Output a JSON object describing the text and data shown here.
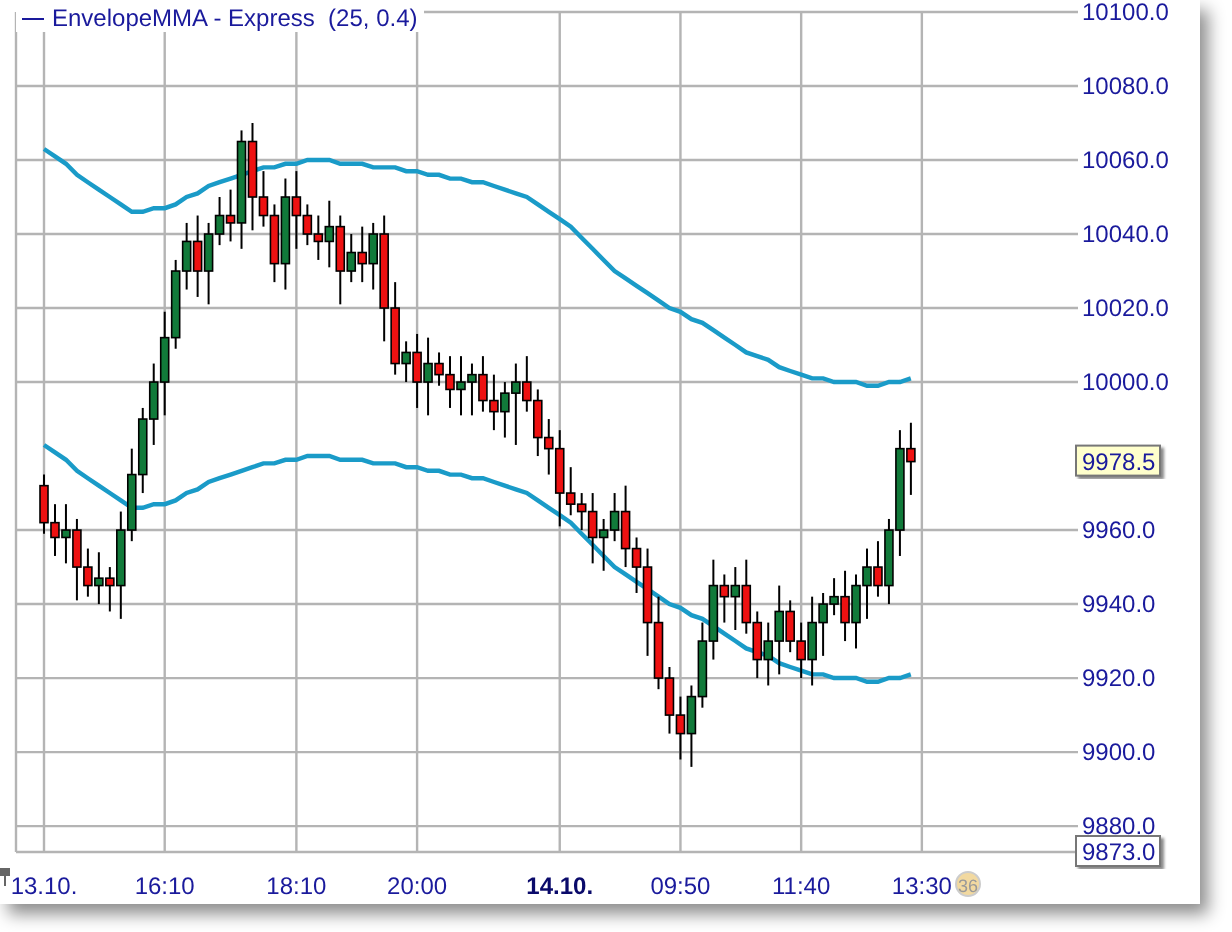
{
  "panel": {
    "chart_data": {
      "type": "candlestick",
      "title": "EnvelopeMMA - Express  (25, 0.4)",
      "categories": [
        "13.10.",
        null,
        null,
        null,
        null,
        null,
        null,
        null,
        null,
        null,
        null,
        "16:10",
        null,
        null,
        null,
        null,
        null,
        null,
        null,
        null,
        null,
        null,
        null,
        "18:10",
        null,
        null,
        null,
        null,
        null,
        null,
        null,
        null,
        null,
        null,
        "20:00",
        null,
        null,
        null,
        null,
        null,
        null,
        null,
        null,
        null,
        null,
        null,
        null,
        "**14.10.**",
        null,
        null,
        null,
        null,
        null,
        null,
        null,
        null,
        null,
        null,
        "09:50",
        null,
        null,
        null,
        null,
        null,
        null,
        null,
        null,
        null,
        null,
        "11:40",
        null,
        null,
        null,
        null,
        null,
        null,
        null,
        null,
        null,
        null,
        "13:30",
        null,
        null,
        null,
        null,
        null,
        null,
        null,
        null,
        null,
        null,
        null,
        null,
        null
      ],
      "grid": true,
      "ylim": [
        9873,
        10100
      ],
      "yticks": [
        {
          "value": 9880,
          "label": "9880.0"
        },
        {
          "value": 9900,
          "label": "9900.0"
        },
        {
          "value": 9920,
          "label": "9920.0"
        },
        {
          "value": 9940,
          "label": "9940.0"
        },
        {
          "value": 9960,
          "label": "9960.0"
        },
        {
          "value": 10000,
          "label": "10000.0"
        },
        {
          "value": 10020,
          "label": "10020.0"
        },
        {
          "value": 10040,
          "label": "10040.0"
        },
        {
          "value": 10060,
          "label": "10060.0"
        },
        {
          "value": 10080,
          "label": "10080.0"
        },
        {
          "value": 10100,
          "label": "10100.0"
        }
      ],
      "ohlc": [
        [
          9972,
          9975,
          9959,
          9962
        ],
        [
          9962,
          9967,
          9953,
          9958
        ],
        [
          9958,
          9967,
          9951,
          9960
        ],
        [
          9960,
          9963,
          9941,
          9950
        ],
        [
          9950,
          9955,
          9942,
          9945
        ],
        [
          9945,
          9954,
          9940,
          9947
        ],
        [
          9947,
          9950,
          9938,
          9945
        ],
        [
          9945,
          9965,
          9936,
          9960
        ],
        [
          9960,
          9982,
          9957,
          9975
        ],
        [
          9975,
          9993,
          9970,
          9990
        ],
        [
          9990,
          10005,
          9983,
          10000
        ],
        [
          10000,
          10019,
          9991,
          10012
        ],
        [
          10012,
          10033,
          10009,
          10030
        ],
        [
          10030,
          10043,
          10025,
          10038
        ],
        [
          10038,
          10045,
          10023,
          10030
        ],
        [
          10030,
          10043,
          10021,
          10040
        ],
        [
          10040,
          10050,
          10037,
          10045
        ],
        [
          10045,
          10052,
          10038,
          10043
        ],
        [
          10043,
          10068,
          10036,
          10065
        ],
        [
          10065,
          10070,
          10041,
          10050
        ],
        [
          10050,
          10057,
          10042,
          10045
        ],
        [
          10045,
          10048,
          10027,
          10032
        ],
        [
          10032,
          10055,
          10025,
          10050
        ],
        [
          10050,
          10057,
          10036,
          10045
        ],
        [
          10045,
          10048,
          10037,
          10040
        ],
        [
          10040,
          10045,
          10033,
          10038
        ],
        [
          10038,
          10049,
          10031,
          10042
        ],
        [
          10042,
          10045,
          10021,
          10030
        ],
        [
          10030,
          10040,
          10027,
          10035
        ],
        [
          10035,
          10042,
          10027,
          10032
        ],
        [
          10032,
          10043,
          10025,
          10040
        ],
        [
          10040,
          10045,
          10011,
          10020
        ],
        [
          10020,
          10027,
          10002,
          10005
        ],
        [
          10005,
          10011,
          10000,
          10008
        ],
        [
          10008,
          10013,
          9993,
          10000
        ],
        [
          10000,
          10012,
          9991,
          10005
        ],
        [
          10005,
          10008,
          9999,
          10002
        ],
        [
          10002,
          10007,
          9993,
          9998
        ],
        [
          9998,
          10007,
          9991,
          10000
        ],
        [
          10000,
          10005,
          9991,
          10002
        ],
        [
          10002,
          10007,
          9992,
          9995
        ],
        [
          9995,
          10002,
          9987,
          9992
        ],
        [
          9992,
          10000,
          9985,
          9997
        ],
        [
          9997,
          10005,
          9983,
          10000
        ],
        [
          10000,
          10007,
          9992,
          9995
        ],
        [
          9995,
          9998,
          9980,
          9985
        ],
        [
          9985,
          9990,
          9975,
          9982
        ],
        [
          9982,
          9987,
          9961,
          9970
        ],
        [
          9970,
          9977,
          9964,
          9967
        ],
        [
          9967,
          9970,
          9960,
          9965
        ],
        [
          9965,
          9970,
          9951,
          9958
        ],
        [
          9958,
          9963,
          9949,
          9960
        ],
        [
          9960,
          9970,
          9957,
          9965
        ],
        [
          9965,
          9972,
          9950,
          9955
        ],
        [
          9955,
          9958,
          9943,
          9950
        ],
        [
          9950,
          9955,
          9926,
          9935
        ],
        [
          9935,
          9942,
          9917,
          9920
        ],
        [
          9920,
          9923,
          9905,
          9910
        ],
        [
          9910,
          9915,
          9898,
          9905
        ],
        [
          9905,
          9918,
          9896,
          9915
        ],
        [
          9915,
          9935,
          9912,
          9930
        ],
        [
          9930,
          9952,
          9925,
          9945
        ],
        [
          9945,
          9948,
          9935,
          9942
        ],
        [
          9942,
          9950,
          9933,
          9945
        ],
        [
          9945,
          9952,
          9932,
          9935
        ],
        [
          9935,
          9938,
          9920,
          9925
        ],
        [
          9925,
          9935,
          9918,
          9930
        ],
        [
          9930,
          9945,
          9921,
          9938
        ],
        [
          9938,
          9941,
          9927,
          9930
        ],
        [
          9930,
          9935,
          9920,
          9925
        ],
        [
          9925,
          9942,
          9918,
          9935
        ],
        [
          9935,
          9943,
          9926,
          9940
        ],
        [
          9940,
          9947,
          9937,
          9942
        ],
        [
          9942,
          9949,
          9930,
          9935
        ],
        [
          9935,
          9948,
          9928,
          9945
        ],
        [
          9945,
          9955,
          9936,
          9950
        ],
        [
          9950,
          9957,
          9942,
          9945
        ],
        [
          9945,
          9963,
          9940,
          9960
        ],
        [
          9960,
          9987,
          9953,
          9982
        ],
        [
          9982,
          9989,
          9969.5,
          9978.5
        ],
        null,
        null,
        null,
        null,
        null,
        null,
        null,
        null,
        null,
        null,
        null,
        null,
        null,
        null
      ],
      "series": [
        {
          "type": "line",
          "color": "#1a9bc8",
          "values": [
            10063,
            10061,
            10059,
            10056,
            10054,
            10052,
            10050,
            10048,
            10046,
            10046,
            10047,
            10047,
            10048,
            10050,
            10051,
            10053,
            10054,
            10055,
            10056,
            10057,
            10058,
            10058,
            10059,
            10059,
            10060,
            10060,
            10060,
            10059,
            10059,
            10059,
            10058,
            10058,
            10058,
            10057,
            10057,
            10056,
            10056,
            10055,
            10055,
            10054,
            10054,
            10053,
            10052,
            10051,
            10050,
            10048,
            10046,
            10044,
            10042,
            10039,
            10036,
            10033,
            10030,
            10028,
            10026,
            10024,
            10022,
            10020,
            10019,
            10017,
            10016,
            10014,
            10012,
            10010,
            10008,
            10007,
            10006,
            10004,
            10003,
            10002,
            10001,
            10001,
            10000,
            10000,
            10000,
            9999,
            9999,
            10000,
            10000,
            10001,
            null,
            null,
            null,
            null,
            null,
            null,
            null,
            null,
            null,
            null,
            null,
            null,
            null,
            null
          ]
        },
        {
          "type": "line",
          "color": "#1a9bc8",
          "values": [
            9983,
            9981,
            9979,
            9976,
            9974,
            9972,
            9970,
            9968,
            9966,
            9966,
            9967,
            9967,
            9968,
            9970,
            9971,
            9973,
            9974,
            9975,
            9976,
            9977,
            9978,
            9978,
            9979,
            9979,
            9980,
            9980,
            9980,
            9979,
            9979,
            9979,
            9978,
            9978,
            9978,
            9977,
            9977,
            9976,
            9976,
            9975,
            9975,
            9974,
            9974,
            9973,
            9972,
            9971,
            9970,
            9968,
            9966,
            9964,
            9962,
            9959,
            9956,
            9953,
            9950,
            9948,
            9946,
            9944,
            9942,
            9940,
            9939,
            9937,
            9936,
            9934,
            9932,
            9930,
            9928,
            9927,
            9926,
            9924,
            9923,
            9922,
            9921,
            9921,
            9920,
            9920,
            9920,
            9919,
            9919,
            9920,
            9920,
            9921,
            null,
            null,
            null,
            null,
            null,
            null,
            null,
            null,
            null,
            null,
            null,
            null,
            null,
            null
          ]
        }
      ]
    },
    "price_tags": [
      {
        "label": "9978.5",
        "kind": "last"
      },
      {
        "label": "9873.0",
        "kind": "low"
      }
    ],
    "bar_timer": "36"
  }
}
